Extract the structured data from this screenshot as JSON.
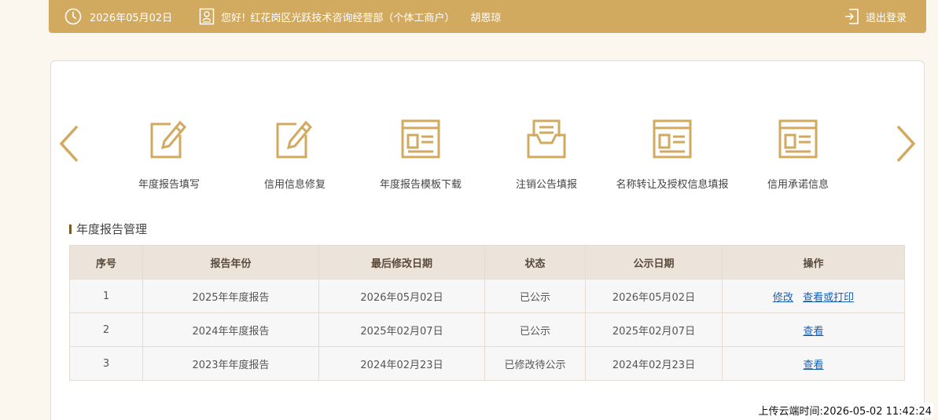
{
  "topbar": {
    "date": "2026年05月02日",
    "greeting": "您好!",
    "company": "红花岗区光跃技术咨询经营部（个体工商户）",
    "user": "胡恩琼",
    "logout": "退出登录"
  },
  "icons": [
    {
      "label": "年度报告填写",
      "icon": "edit-icon"
    },
    {
      "label": "信用信息修复",
      "icon": "edit-icon"
    },
    {
      "label": "年度报告模板下载",
      "icon": "template-icon"
    },
    {
      "label": "注销公告填报",
      "icon": "inbox-icon"
    },
    {
      "label": "名称转让及授权信息填报",
      "icon": "template-icon"
    },
    {
      "label": "信用承诺信息",
      "icon": "template-icon"
    }
  ],
  "section_title": "年度报告管理",
  "table": {
    "headers": [
      "序号",
      "报告年份",
      "最后修改日期",
      "状态",
      "公示日期",
      "操作"
    ],
    "rows": [
      {
        "no": "1",
        "year": "2025年年度报告",
        "modified": "2026年05月02日",
        "status": "已公示",
        "publish": "2026年05月02日",
        "actions": [
          "修改",
          "查看或打印"
        ]
      },
      {
        "no": "2",
        "year": "2024年年度报告",
        "modified": "2025年02月07日",
        "status": "已公示",
        "publish": "2025年02月07日",
        "actions": [
          "查看"
        ]
      },
      {
        "no": "3",
        "year": "2023年年度报告",
        "modified": "2024年02月23日",
        "status": "已修改待公示",
        "publish": "2024年02月23日",
        "actions": [
          "查看"
        ]
      }
    ]
  },
  "upload_time": "上传云端时间:2026-05-02 11:42:24",
  "colors": {
    "accent": "#d2aa5f",
    "link": "#1a5fb4",
    "table_header": "#ece4da"
  }
}
